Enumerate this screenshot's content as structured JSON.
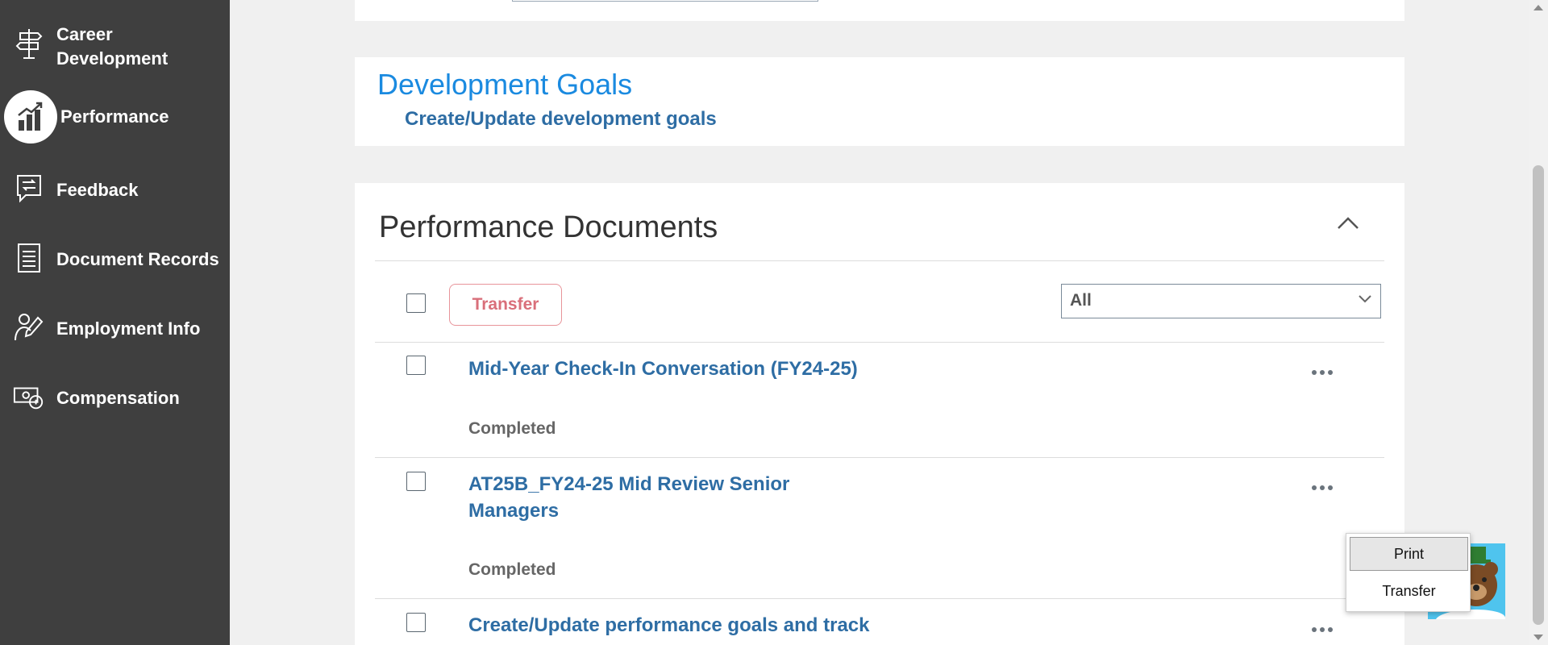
{
  "sidebar": {
    "items": [
      {
        "label_line1": "Career",
        "label_line2": "Development",
        "icon": "signpost-icon"
      },
      {
        "label": "Performance",
        "icon": "bar-chart-icon",
        "active": true
      },
      {
        "label": "Feedback",
        "icon": "feedback-icon"
      },
      {
        "label": "Document Records",
        "icon": "document-icon"
      },
      {
        "label": "Employment Info",
        "icon": "person-pen-icon"
      },
      {
        "label": "Compensation",
        "icon": "money-icon"
      }
    ]
  },
  "development_goals": {
    "title": "Development Goals",
    "link": "Create/Update development goals"
  },
  "performance_documents": {
    "title": "Performance Documents",
    "transfer_label": "Transfer",
    "filter_value": "All",
    "documents": [
      {
        "title_line1": "Mid-Year Check-In Conversation (FY24-25)",
        "title_line2": "",
        "status": "Completed"
      },
      {
        "title_line1": "AT25B_FY24-25 Mid Review Senior",
        "title_line2": "Managers",
        "status": "Completed"
      },
      {
        "title_line1": "Create/Update performance goals and track",
        "title_line2": "",
        "status": ""
      }
    ]
  },
  "popup_menu": {
    "items": [
      "Print",
      "Transfer"
    ]
  },
  "colors": {
    "sidebar_bg": "#3f3f3f",
    "link": "#2e6da4",
    "heading_blue": "#1a8ae0",
    "transfer_disabled": "#d96f7a"
  }
}
